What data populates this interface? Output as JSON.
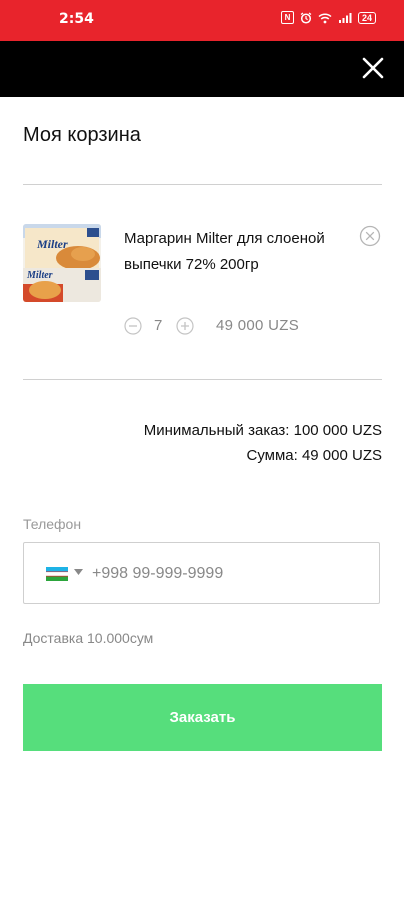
{
  "status_bar": {
    "time": "2:54",
    "nfc_label": "N",
    "battery": "24"
  },
  "cart": {
    "title": "Моя корзина",
    "items": [
      {
        "name": "Маргарин Milter для слоеной выпечки 72% 200гр",
        "quantity": "7",
        "price": "49 000 UZS",
        "image_text": "Milter"
      }
    ]
  },
  "summary": {
    "min_order": "Минимальный заказ: 100 000 UZS",
    "total": "Сумма: 49 000 UZS"
  },
  "phone": {
    "label": "Телефон",
    "placeholder": "+998 99-999-9999",
    "country": "Uzbekistan"
  },
  "delivery": "Доставка 10.000сум",
  "order_button": "Заказать",
  "colors": {
    "status_bar": "#e8242c",
    "header": "#000000",
    "order_button": "#56de7c"
  }
}
